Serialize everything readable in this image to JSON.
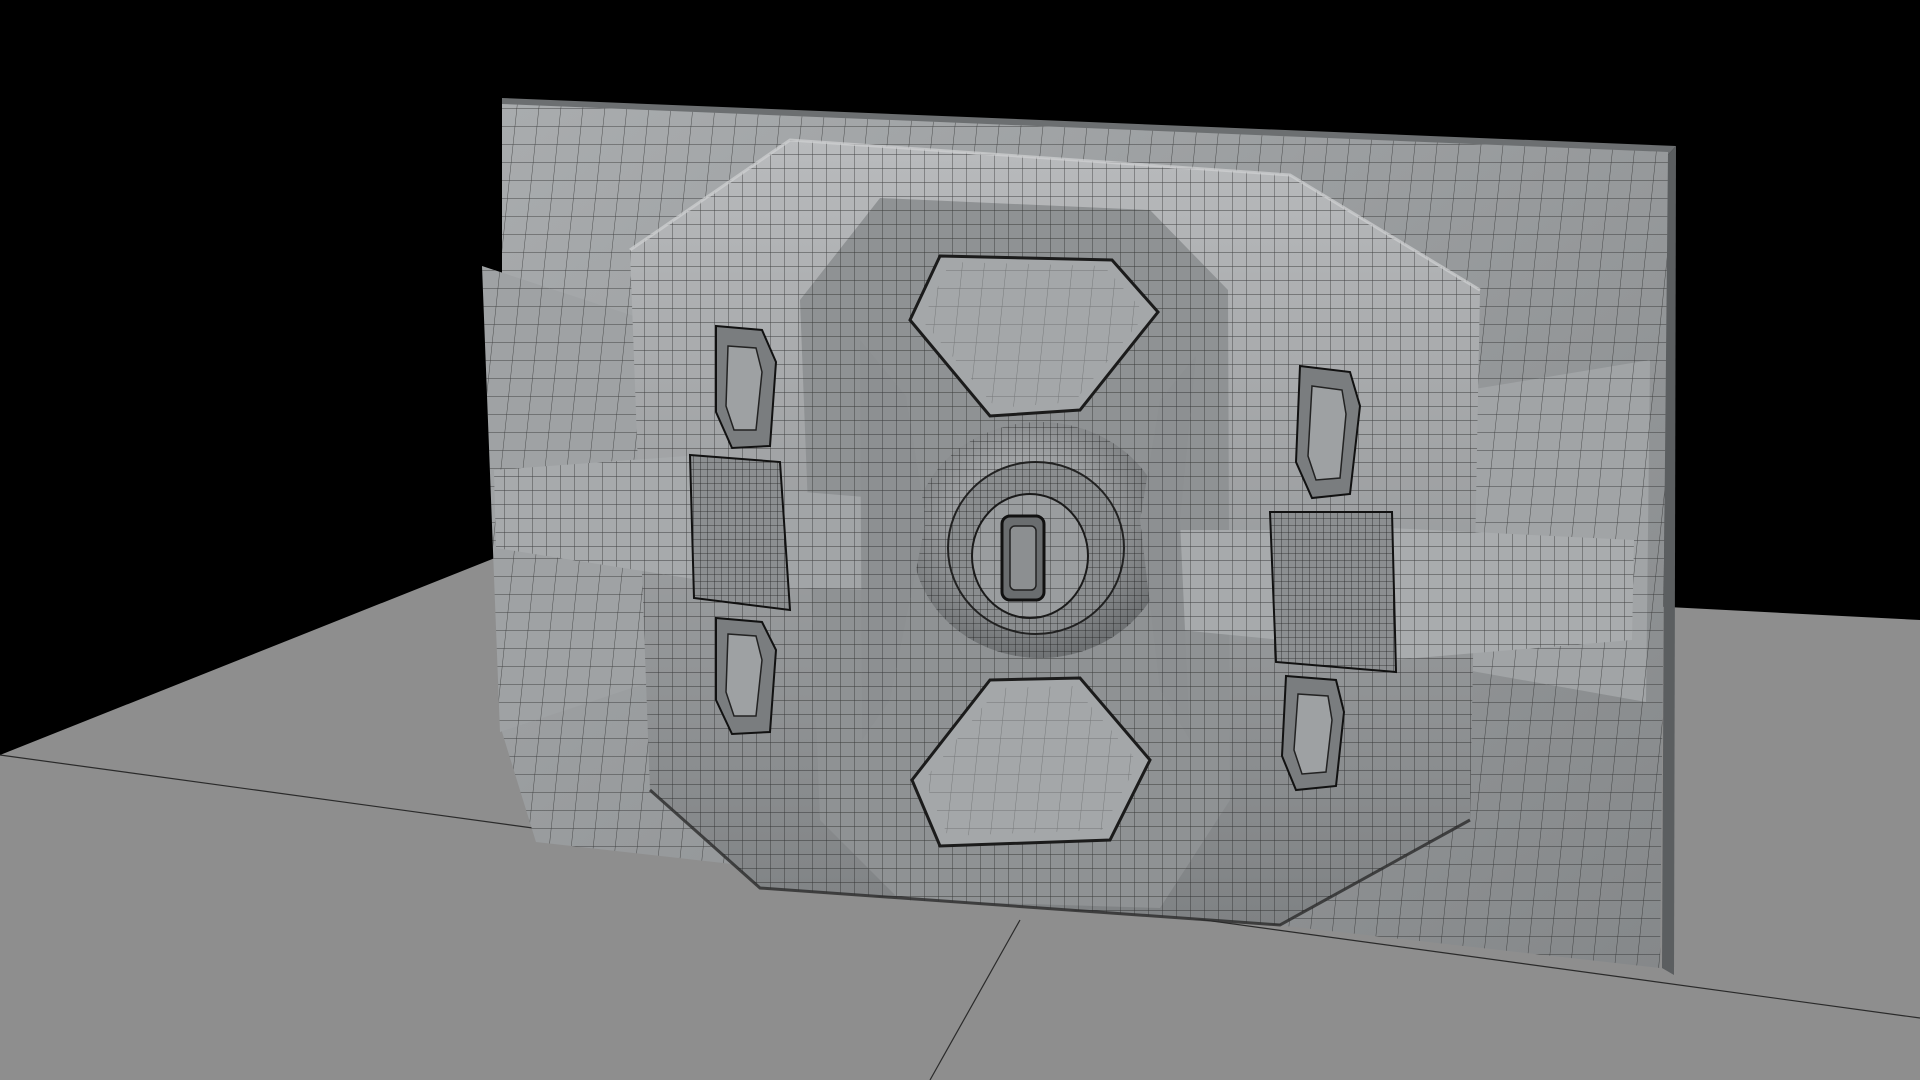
{
  "scene": {
    "background_color": "#000000",
    "floor_color": "#8e8e8e",
    "panel_color": "#9a9d9f",
    "wire_color": "#1a1a1a",
    "highlight_color": "#c4c6c7"
  }
}
